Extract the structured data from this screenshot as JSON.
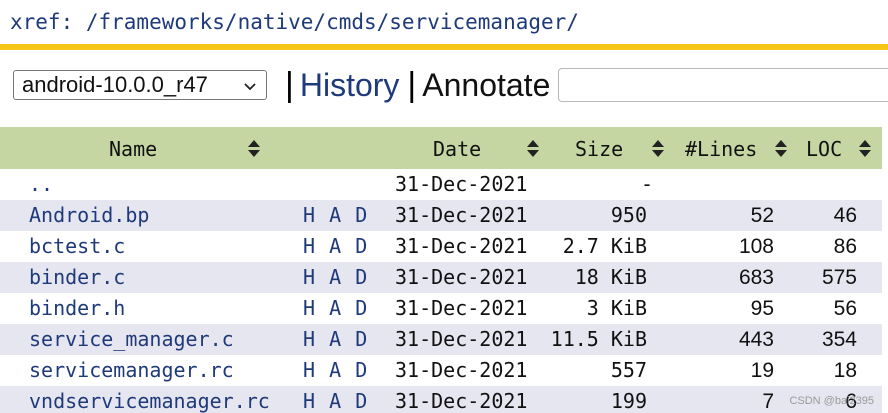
{
  "header": {
    "xref_path": "xref: /frameworks/native/cmds/servicemanager/"
  },
  "toolbar": {
    "branch_selected": "android-10.0.0_r47",
    "separator": "|",
    "history_label": "History",
    "annotate_label": "Annotate"
  },
  "table": {
    "columns": {
      "name": "Name",
      "date": "Date",
      "size": "Size",
      "lines": "#Lines",
      "loc": "LOC"
    },
    "rows": [
      {
        "name": "..",
        "h": "",
        "a": "",
        "d": "",
        "date": "31-Dec-2021",
        "size": "-",
        "lines": "",
        "loc": ""
      },
      {
        "name": "Android.bp",
        "h": "H",
        "a": "A",
        "d": "D",
        "date": "31-Dec-2021",
        "size": "950",
        "lines": "52",
        "loc": "46"
      },
      {
        "name": "bctest.c",
        "h": "H",
        "a": "A",
        "d": "D",
        "date": "31-Dec-2021",
        "size": "2.7 KiB",
        "lines": "108",
        "loc": "86"
      },
      {
        "name": "binder.c",
        "h": "H",
        "a": "A",
        "d": "D",
        "date": "31-Dec-2021",
        "size": "18 KiB",
        "lines": "683",
        "loc": "575"
      },
      {
        "name": "binder.h",
        "h": "H",
        "a": "A",
        "d": "D",
        "date": "31-Dec-2021",
        "size": "3 KiB",
        "lines": "95",
        "loc": "56"
      },
      {
        "name": "service_manager.c",
        "h": "H",
        "a": "A",
        "d": "D",
        "date": "31-Dec-2021",
        "size": "11.5 KiB",
        "lines": "443",
        "loc": "354"
      },
      {
        "name": "servicemanager.rc",
        "h": "H",
        "a": "A",
        "d": "D",
        "date": "31-Dec-2021",
        "size": "557",
        "lines": "19",
        "loc": "18"
      },
      {
        "name": "vndservicemanager.rc",
        "h": "H",
        "a": "A",
        "d": "D",
        "date": "31-Dec-2021",
        "size": "199",
        "lines": "7",
        "loc": "6"
      }
    ]
  },
  "watermark": "CSDN @bai2395",
  "colors": {
    "link": "#1f3a7a",
    "header_bar": "#c5d6a2",
    "alt_row": "#e6e6f0",
    "accent_bar": "#f5c518"
  },
  "icons": {
    "select": "chevron-down-icon",
    "sort": "sort-arrows-icon"
  }
}
